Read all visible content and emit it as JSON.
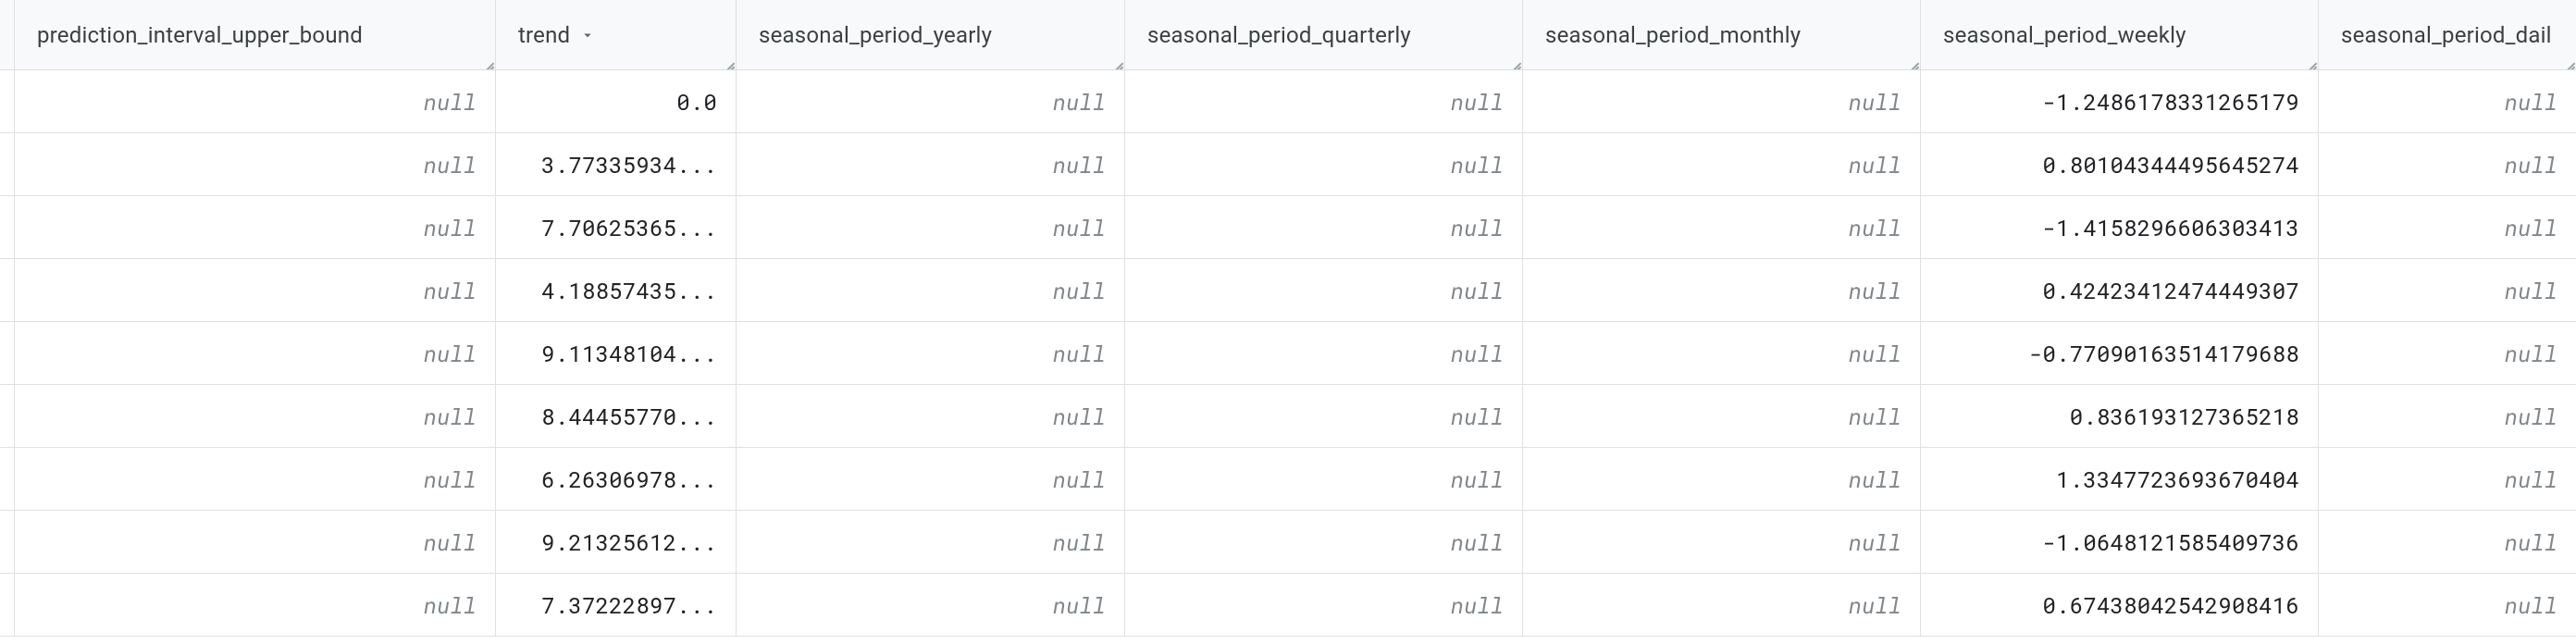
{
  "columns": [
    {
      "key": "prediction_interval_upper_bound",
      "label": "prediction_interval_upper_bound",
      "sorted": false
    },
    {
      "key": "trend",
      "label": "trend",
      "sorted": true
    },
    {
      "key": "seasonal_period_yearly",
      "label": "seasonal_period_yearly",
      "sorted": false
    },
    {
      "key": "seasonal_period_quarterly",
      "label": "seasonal_period_quarterly",
      "sorted": false
    },
    {
      "key": "seasonal_period_monthly",
      "label": "seasonal_period_monthly",
      "sorted": false
    },
    {
      "key": "seasonal_period_weekly",
      "label": "seasonal_period_weekly",
      "sorted": false
    },
    {
      "key": "seasonal_period_daily",
      "label": "seasonal_period_dail",
      "sorted": false
    }
  ],
  "null_label": "null",
  "rows": [
    {
      "prediction_interval_upper_bound": null,
      "trend": "0.0",
      "seasonal_period_yearly": null,
      "seasonal_period_quarterly": null,
      "seasonal_period_monthly": null,
      "seasonal_period_weekly": "-1.2486178331265179",
      "seasonal_period_daily": null
    },
    {
      "prediction_interval_upper_bound": null,
      "trend": "3.77335934...",
      "seasonal_period_yearly": null,
      "seasonal_period_quarterly": null,
      "seasonal_period_monthly": null,
      "seasonal_period_weekly": "0.80104344495645274",
      "seasonal_period_daily": null
    },
    {
      "prediction_interval_upper_bound": null,
      "trend": "7.70625365...",
      "seasonal_period_yearly": null,
      "seasonal_period_quarterly": null,
      "seasonal_period_monthly": null,
      "seasonal_period_weekly": "-1.4158296606303413",
      "seasonal_period_daily": null
    },
    {
      "prediction_interval_upper_bound": null,
      "trend": "4.18857435...",
      "seasonal_period_yearly": null,
      "seasonal_period_quarterly": null,
      "seasonal_period_monthly": null,
      "seasonal_period_weekly": "0.42423412474449307",
      "seasonal_period_daily": null
    },
    {
      "prediction_interval_upper_bound": null,
      "trend": "9.11348104...",
      "seasonal_period_yearly": null,
      "seasonal_period_quarterly": null,
      "seasonal_period_monthly": null,
      "seasonal_period_weekly": "-0.77090163514179688",
      "seasonal_period_daily": null
    },
    {
      "prediction_interval_upper_bound": null,
      "trend": "8.44455770...",
      "seasonal_period_yearly": null,
      "seasonal_period_quarterly": null,
      "seasonal_period_monthly": null,
      "seasonal_period_weekly": "0.836193127365218",
      "seasonal_period_daily": null
    },
    {
      "prediction_interval_upper_bound": null,
      "trend": "6.26306978...",
      "seasonal_period_yearly": null,
      "seasonal_period_quarterly": null,
      "seasonal_period_monthly": null,
      "seasonal_period_weekly": "1.3347723693670404",
      "seasonal_period_daily": null
    },
    {
      "prediction_interval_upper_bound": null,
      "trend": "9.21325612...",
      "seasonal_period_yearly": null,
      "seasonal_period_quarterly": null,
      "seasonal_period_monthly": null,
      "seasonal_period_weekly": "-1.0648121585409736",
      "seasonal_period_daily": null
    },
    {
      "prediction_interval_upper_bound": null,
      "trend": "7.37222897...",
      "seasonal_period_yearly": null,
      "seasonal_period_quarterly": null,
      "seasonal_period_monthly": null,
      "seasonal_period_weekly": "0.67438042542908416",
      "seasonal_period_daily": null
    }
  ]
}
